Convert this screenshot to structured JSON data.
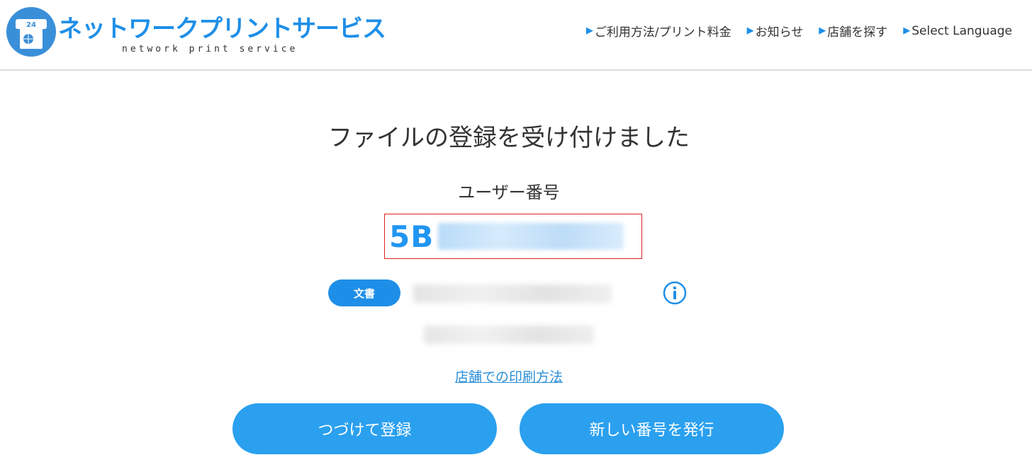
{
  "header": {
    "logo_title": "ネットワークプリントサービス",
    "logo_subtitle": "network print service",
    "logo_badge": "24",
    "nav": [
      {
        "label": "ご利用方法/プリント料金"
      },
      {
        "label": "お知らせ"
      },
      {
        "label": "店舗を探す"
      },
      {
        "label": "Select Language"
      }
    ]
  },
  "main": {
    "title": "ファイルの登録を受け付けました",
    "user_number_label": "ユーザー番号",
    "user_number_visible": "5B",
    "document_badge": "文書",
    "print_method_link": "店舗での印刷方法",
    "buttons": {
      "continue": "つづけて登録",
      "new_number": "新しい番号を発行"
    }
  },
  "colors": {
    "brand_blue": "#1e8fe8",
    "button_blue": "#2aa0ef",
    "highlight_red": "#e02020"
  }
}
